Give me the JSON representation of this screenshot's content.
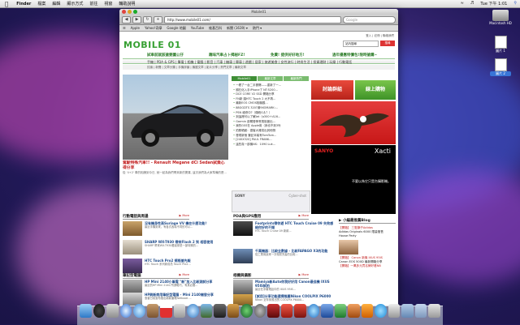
{
  "menubar": {
    "app_name": "Finder",
    "items": [
      "檔案",
      "編輯",
      "顯示方式",
      "前往",
      "視窗",
      "輔助說明"
    ],
    "clock": "Tue 下午 1:01"
  },
  "window": {
    "title": "Mobile01",
    "url": "http://www.mobile01.com/",
    "search_placeholder": "Google",
    "bookmarks": [
      "Apple",
      "Yahoo!奇摩",
      "Google 地圖",
      "YouTube",
      "維基百科",
      "新聞 (1639) ▾",
      "熱門 ▾"
    ]
  },
  "site": {
    "logo": "MOBILE 01",
    "top_links": "登入 | 註冊 | 聯絡我們",
    "search_value": "站內搜尋",
    "search_button": "搜尋",
    "promos": [
      "試車前就該搶要圖公仔",
      "趣味汽車占卜揭秘FZ!",
      "免費! 提供好好地方!",
      "過年優惠特價包!限時搶購~"
    ],
    "nav": "手機 | PDA & GPS | 筆電 | 相機 | 電腦 | 影音 | 汽車 | 機車 | 單車 | 遊戲 | 居家 | 旅遊美食 | 女性流行 | 時尚生活 | 投資理財 | 玩樂 | 行動電話",
    "subnav": "討論 | 新聞 | 文章分類 | 手機評論 | 機麗文章 | 影片分享 | 熱門文章 | 最新文章",
    "headline": "駕駛特殊汽車!! - Renault Megane dCi Sedan試乘心得分享",
    "headline_sub": "從 '4+2' 車的相識到今日, 就一起為我們帶來新的驚喜, 這次我們為大家準備的是...",
    "tabs": [
      "Mobile01",
      "最新文章",
      "最新熱門"
    ],
    "news": [
      "一看了一台二手寶縣——重新了一...",
      "鑽石化入手iPhone了 NT:5200...",
      "DCE CORE V2 SSD 開箱分享",
      "FN新 讓HTC Touch 2 大不再...",
      "最新EOS CMOS相機觀...",
      "88GGDTS 320?滿9XOMARK:...",
      "PSN 維修中?（傳統G＆？）",
      "到這裡可以了解Jet（a300＋A16...",
      "Garmin 部屬發佈會員制度出...",
      "我的GSS在 Apple用（我也不到3吋",
      "拍照晒館：讀客大雅寫出其他物",
      "發現新宿 筆記本裝有TomTom...",
      "[240X320] PAUL FRANK...",
      "這些真一部機NS：1090 Luk..."
    ],
    "ad_left": "SONY",
    "ad_left_brand": "Cyber-shot",
    "ad_right_1": "討論群組",
    "ad_right_2": "線上購物",
    "ad_right_4_brand": "SANYO",
    "ad_right_4_model": "Xacti",
    "ad_right_4_caption": "不要以為它只是台攝影機。"
  },
  "sections": {
    "left_1": {
      "title": "行動電話與周邊",
      "more": "▶ More",
      "items": [
        {
          "title": "沒有機身性高Suriage VV 機在什麼功能？",
          "desc": "最近手機到來，有各式各樣不同的可以..."
        },
        {
          "title": "SHARP WX-T930 帶來Flash 2 到 相容使用",
          "desc": "SHARP 帶來WX-T930看起來是一部特殊的..."
        },
        {
          "title": "HTC Touch Pro2 規格搶先報",
          "desc": "HTC Touch 系列新成員 Touch Pro2..."
        }
      ]
    },
    "left_2": {
      "title": "筆記型電腦",
      "more": "▶ More",
      "items": [
        {
          "title": "HP Mini 2140小筆電 \"新\"加入比較測試分享",
          "desc": "最近的HP Mini 2140 所謂輕巧，有其必要..."
        },
        {
          "title": "HP刷新商用筆記型電腦 - Mini 2140開發分享",
          "desc": "惠普日前宣布推出新款筆電Netbook ..."
        }
      ]
    },
    "mid_1": {
      "title": "PDA與GPS應用",
      "more": "▶ More",
      "items": [
        {
          "title": "Footprints帶你遊 HTC Touch Cruise 09 失效感給你好的不錯",
          "desc": "HTC Touch Cruise 09 新款..."
        },
        {
          "title": "千萬機器：比較全數據 - 比較FAPAGO X3的功能",
          "desc": "從工業用途來一次相當完善的比較..."
        }
      ]
    },
    "mid_2": {
      "title": "相機與攝影",
      "more": "▶ More",
      "items": [
        {
          "title": "Mamiya新Auto你我好好用 Canon最佳機 IXUS 95IS試拍",
          "desc": "最近在手機電話中的 IXUS 95IS..."
        },
        {
          "title": "[試用]分享功能選擇推薦Nikon COOLPIX P6000",
          "desc": "Nikon 近年來推出的 COOLPIX P6000..."
        }
      ]
    },
    "right_1": {
      "title": "▶ 小編最推薦Blog",
      "items": [
        "【開箱】 三隻獅子Adidas",
        "Adidas Originals 6000 限量發售",
        "House Party",
        "【開箱】 Canon 新機 IXUS 95IS",
        "Canon EOS 500D 最新開箱分享",
        "【開箱】一萬多元買名牌好看NB"
      ]
    }
  },
  "desktop": {
    "hd_label": "Macintosh HD",
    "icon_2_label": "圖片 1",
    "icon_3_label": "圖片 2"
  }
}
